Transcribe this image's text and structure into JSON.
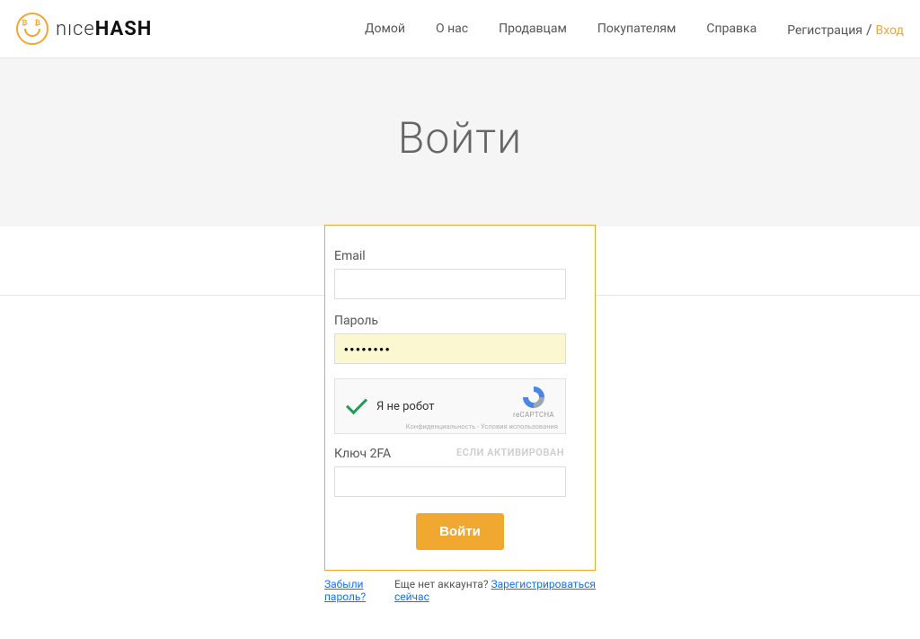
{
  "logo": {
    "left": "nıce",
    "right": "HASH"
  },
  "nav": {
    "home": "Домой",
    "about": "О нас",
    "sellers": "Продавцам",
    "buyers": "Покупателям",
    "help": "Справка",
    "register": "Регистрация",
    "sep": " / ",
    "login": "Вход"
  },
  "hero": {
    "title": "Войти"
  },
  "form": {
    "email_label": "Email",
    "email_value": "",
    "password_label": "Пароль",
    "password_value": "••••••••",
    "captcha_label": "Я не робот",
    "captcha_brand": "reCAPTCHA",
    "captcha_privacy": "Конфиденциальность - Условия использования",
    "twofa_label": "Ключ 2FA",
    "twofa_hint": "ЕСЛИ АКТИВИРОВАН",
    "twofa_value": "",
    "submit": "Войти"
  },
  "under": {
    "forgot": "Забыли пароль?",
    "no_account": "Еще нет аккаунта? ",
    "register_now": "Зарегистрироваться сейчас"
  },
  "colors": {
    "accent": "#f0a830",
    "link": "#1a73e8"
  }
}
